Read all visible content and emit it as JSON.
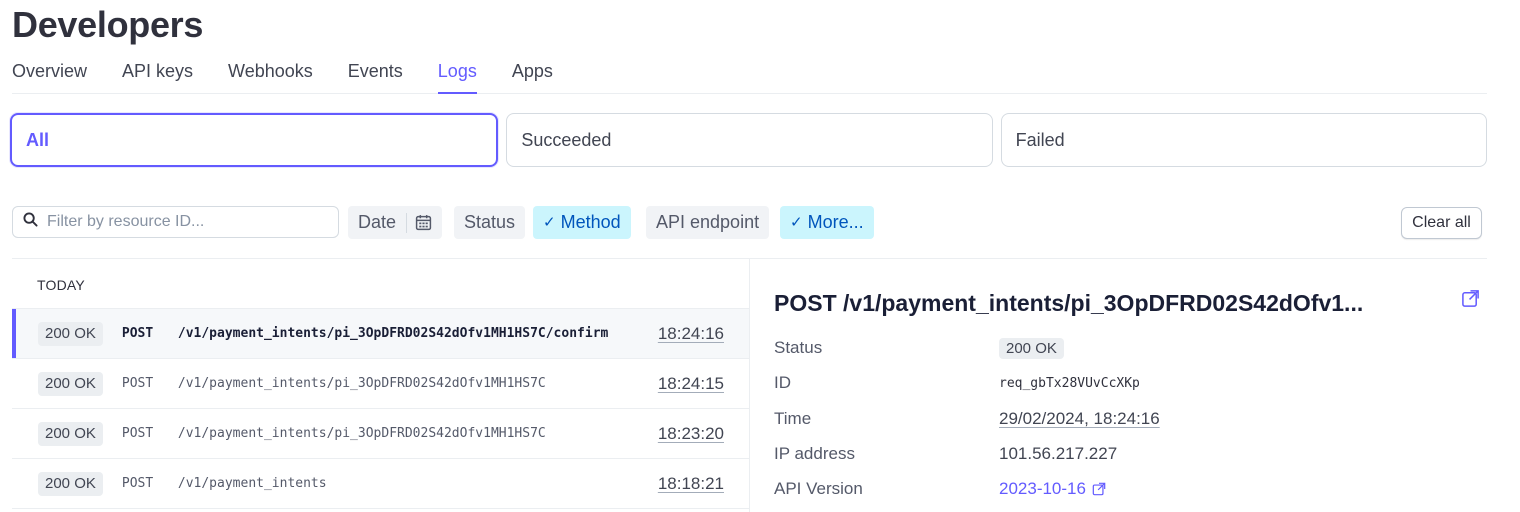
{
  "page": {
    "title": "Developers"
  },
  "tabs": [
    {
      "label": "Overview"
    },
    {
      "label": "API keys"
    },
    {
      "label": "Webhooks"
    },
    {
      "label": "Events"
    },
    {
      "label": "Logs",
      "active": true
    },
    {
      "label": "Apps"
    }
  ],
  "segments": [
    {
      "label": "All",
      "active": true
    },
    {
      "label": "Succeeded"
    },
    {
      "label": "Failed"
    }
  ],
  "filters": {
    "search_placeholder": "Filter by resource ID...",
    "date": "Date",
    "status": "Status",
    "method": "Method",
    "api_endpoint": "API endpoint",
    "more": "More...",
    "clear_all": "Clear all"
  },
  "logs": {
    "group_label": "TODAY",
    "rows": [
      {
        "status": "200 OK",
        "method": "POST",
        "path": "/v1/payment_intents/pi_3OpDFRD02S42dOfv1MH1HS7C/confirm",
        "time": "18:24:16"
      },
      {
        "status": "200 OK",
        "method": "POST",
        "path": "/v1/payment_intents/pi_3OpDFRD02S42dOfv1MH1HS7C",
        "time": "18:24:15"
      },
      {
        "status": "200 OK",
        "method": "POST",
        "path": "/v1/payment_intents/pi_3OpDFRD02S42dOfv1MH1HS7C",
        "time": "18:23:20"
      },
      {
        "status": "200 OK",
        "method": "POST",
        "path": "/v1/payment_intents",
        "time": "18:18:21"
      }
    ]
  },
  "detail": {
    "title": "POST /v1/payment_intents/pi_3OpDFRD02S42dOfv1...",
    "fields": {
      "status_label": "Status",
      "status_value": "200 OK",
      "id_label": "ID",
      "id_value": "req_gbTx28VUvCcXKp",
      "time_label": "Time",
      "time_value": "29/02/2024, 18:24:16",
      "ip_label": "IP address",
      "ip_value": "101.56.217.227",
      "version_label": "API Version",
      "version_value": "2023-10-16"
    }
  },
  "colors": {
    "accent": "#635bff",
    "chip_selected_bg": "#cbf5fd",
    "chip_selected_text": "#0055bc"
  },
  "icons": [
    "search-icon",
    "calendar-icon",
    "check-icon",
    "external-link-icon"
  ]
}
